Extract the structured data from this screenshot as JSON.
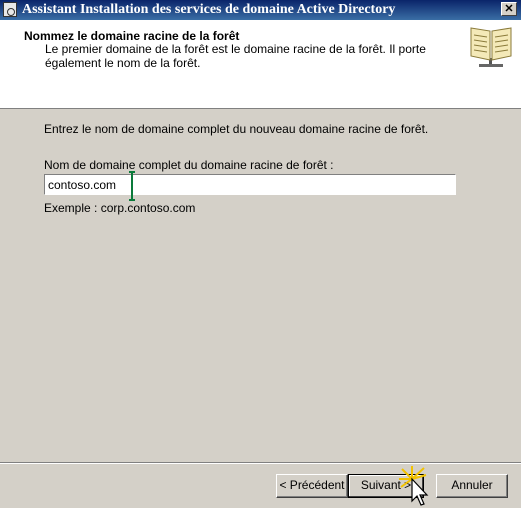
{
  "window": {
    "title": "Assistant Installation des services de domaine Active Directory",
    "close_label": "✕"
  },
  "header": {
    "title": "Nommez le domaine racine de la forêt",
    "description": "Le premier domaine de la forêt est le domaine racine de la forêt. Il porte également le nom de la forêt."
  },
  "main": {
    "intro": "Entrez le nom de domaine complet du nouveau domaine racine de forêt.",
    "field_label": "Nom de domaine complet du domaine racine de forêt :",
    "field_value": "contoso.com",
    "example": "Exemple : corp.contoso.com"
  },
  "buttons": {
    "previous": "< Précédent",
    "next": "Suivant >",
    "cancel": "Annuler"
  },
  "icons": [
    "wizard-app-icon",
    "book-icon",
    "text-cursor-icon",
    "mouse-pointer-icon"
  ]
}
